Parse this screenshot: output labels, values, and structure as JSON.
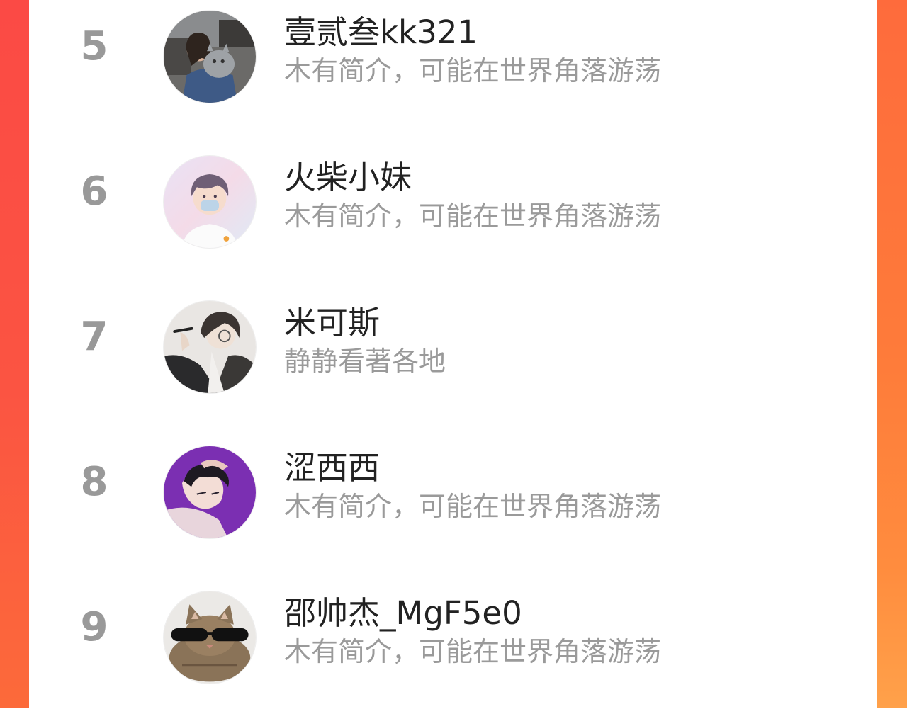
{
  "ranking": {
    "items": [
      {
        "rank": "5",
        "name": "壹贰叁kk321",
        "bio": "木有简介，可能在世界角落游荡",
        "avatar": "woman-with-cat-photo"
      },
      {
        "rank": "6",
        "name": "火柴小妹",
        "bio": "木有简介，可能在世界角落游荡",
        "avatar": "anime-boy-mask-illustration"
      },
      {
        "rank": "7",
        "name": "米可斯",
        "bio": "静静看著各地",
        "avatar": "anime-man-glasses-illustration"
      },
      {
        "rank": "8",
        "name": "涩西西",
        "bio": "木有简介，可能在世界角落游荡",
        "avatar": "anime-man-purple-background"
      },
      {
        "rank": "9",
        "name": "邵帅杰_MgF5e0",
        "bio": "木有简介，可能在世界角落游荡",
        "avatar": "cat-with-sunglasses-photo"
      }
    ]
  }
}
